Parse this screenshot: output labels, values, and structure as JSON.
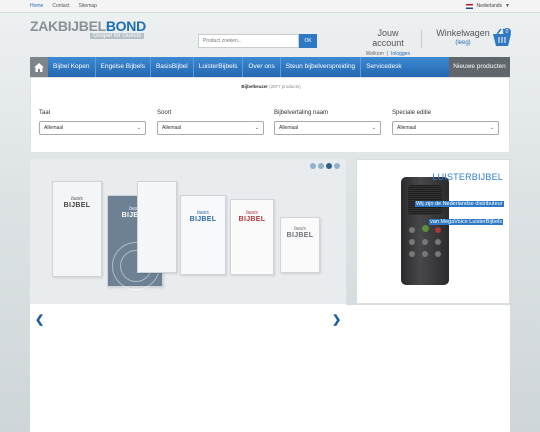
{
  "topbar": {
    "links": [
      "Home",
      "Contact",
      "Sitemap"
    ],
    "language": "Nederlands"
  },
  "logo": {
    "word1": "ZAKBIJBEL",
    "word2": "BOND",
    "tagline": "Gospel for Guests"
  },
  "search": {
    "placeholder": "Product zoeken...",
    "button": "OK"
  },
  "account": {
    "title": "Jouw account",
    "links": [
      "Welkom",
      "Inloggen"
    ]
  },
  "cart": {
    "title": "Winkelwagen",
    "status": "(leeg)",
    "count": "0"
  },
  "nav": {
    "items": [
      "Bijbel Kopen",
      "Engelse Bijbels",
      "BasisBijbel",
      "LuisterBijbels",
      "Over ons",
      "Steun bijbelverspreiding",
      "Servicedesk"
    ],
    "new_products": "Nieuwe producten"
  },
  "filter": {
    "crumb_title": "Bijbelkeuzer",
    "crumb_count": "(2877 products)",
    "fields": [
      {
        "label": "Taal",
        "value": "Allemaal"
      },
      {
        "label": "Soort",
        "value": "Allemaal"
      },
      {
        "label": "Bijbelvertaling naam",
        "value": "Allemaal"
      },
      {
        "label": "Speciale editie",
        "value": "Allemaal"
      }
    ]
  },
  "slider": {
    "book_script": "basis",
    "book_title": "BIJBEL",
    "dots": 4,
    "active_dot": 2,
    "prev": "❮",
    "next": "❯"
  },
  "side_panel": {
    "heading": "LUISTERBIJBEL",
    "text": "Wij zijn de Nederlandse distributeur van MegaVoice LuisterBijbels"
  },
  "colors": {
    "accent": "#2f79c4",
    "nav_start": "#3d89d3",
    "nav_end": "#2468b0",
    "dark_tab": "#60676c"
  },
  "icons": {
    "home": "home-icon",
    "cart": "basket-icon",
    "flag": "dutch-flag-icon"
  }
}
